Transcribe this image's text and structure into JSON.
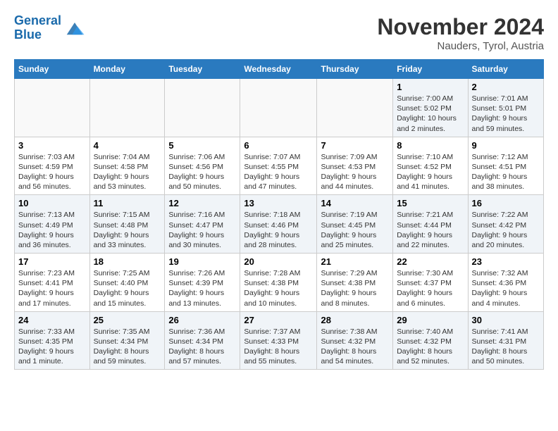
{
  "header": {
    "logo_line1": "General",
    "logo_line2": "Blue",
    "month": "November 2024",
    "location": "Nauders, Tyrol, Austria"
  },
  "weekdays": [
    "Sunday",
    "Monday",
    "Tuesday",
    "Wednesday",
    "Thursday",
    "Friday",
    "Saturday"
  ],
  "weeks": [
    [
      {
        "day": "",
        "info": ""
      },
      {
        "day": "",
        "info": ""
      },
      {
        "day": "",
        "info": ""
      },
      {
        "day": "",
        "info": ""
      },
      {
        "day": "",
        "info": ""
      },
      {
        "day": "1",
        "info": "Sunrise: 7:00 AM\nSunset: 5:02 PM\nDaylight: 10 hours and 2 minutes."
      },
      {
        "day": "2",
        "info": "Sunrise: 7:01 AM\nSunset: 5:01 PM\nDaylight: 9 hours and 59 minutes."
      }
    ],
    [
      {
        "day": "3",
        "info": "Sunrise: 7:03 AM\nSunset: 4:59 PM\nDaylight: 9 hours and 56 minutes."
      },
      {
        "day": "4",
        "info": "Sunrise: 7:04 AM\nSunset: 4:58 PM\nDaylight: 9 hours and 53 minutes."
      },
      {
        "day": "5",
        "info": "Sunrise: 7:06 AM\nSunset: 4:56 PM\nDaylight: 9 hours and 50 minutes."
      },
      {
        "day": "6",
        "info": "Sunrise: 7:07 AM\nSunset: 4:55 PM\nDaylight: 9 hours and 47 minutes."
      },
      {
        "day": "7",
        "info": "Sunrise: 7:09 AM\nSunset: 4:53 PM\nDaylight: 9 hours and 44 minutes."
      },
      {
        "day": "8",
        "info": "Sunrise: 7:10 AM\nSunset: 4:52 PM\nDaylight: 9 hours and 41 minutes."
      },
      {
        "day": "9",
        "info": "Sunrise: 7:12 AM\nSunset: 4:51 PM\nDaylight: 9 hours and 38 minutes."
      }
    ],
    [
      {
        "day": "10",
        "info": "Sunrise: 7:13 AM\nSunset: 4:49 PM\nDaylight: 9 hours and 36 minutes."
      },
      {
        "day": "11",
        "info": "Sunrise: 7:15 AM\nSunset: 4:48 PM\nDaylight: 9 hours and 33 minutes."
      },
      {
        "day": "12",
        "info": "Sunrise: 7:16 AM\nSunset: 4:47 PM\nDaylight: 9 hours and 30 minutes."
      },
      {
        "day": "13",
        "info": "Sunrise: 7:18 AM\nSunset: 4:46 PM\nDaylight: 9 hours and 28 minutes."
      },
      {
        "day": "14",
        "info": "Sunrise: 7:19 AM\nSunset: 4:45 PM\nDaylight: 9 hours and 25 minutes."
      },
      {
        "day": "15",
        "info": "Sunrise: 7:21 AM\nSunset: 4:44 PM\nDaylight: 9 hours and 22 minutes."
      },
      {
        "day": "16",
        "info": "Sunrise: 7:22 AM\nSunset: 4:42 PM\nDaylight: 9 hours and 20 minutes."
      }
    ],
    [
      {
        "day": "17",
        "info": "Sunrise: 7:23 AM\nSunset: 4:41 PM\nDaylight: 9 hours and 17 minutes."
      },
      {
        "day": "18",
        "info": "Sunrise: 7:25 AM\nSunset: 4:40 PM\nDaylight: 9 hours and 15 minutes."
      },
      {
        "day": "19",
        "info": "Sunrise: 7:26 AM\nSunset: 4:39 PM\nDaylight: 9 hours and 13 minutes."
      },
      {
        "day": "20",
        "info": "Sunrise: 7:28 AM\nSunset: 4:38 PM\nDaylight: 9 hours and 10 minutes."
      },
      {
        "day": "21",
        "info": "Sunrise: 7:29 AM\nSunset: 4:38 PM\nDaylight: 9 hours and 8 minutes."
      },
      {
        "day": "22",
        "info": "Sunrise: 7:30 AM\nSunset: 4:37 PM\nDaylight: 9 hours and 6 minutes."
      },
      {
        "day": "23",
        "info": "Sunrise: 7:32 AM\nSunset: 4:36 PM\nDaylight: 9 hours and 4 minutes."
      }
    ],
    [
      {
        "day": "24",
        "info": "Sunrise: 7:33 AM\nSunset: 4:35 PM\nDaylight: 9 hours and 1 minute."
      },
      {
        "day": "25",
        "info": "Sunrise: 7:35 AM\nSunset: 4:34 PM\nDaylight: 8 hours and 59 minutes."
      },
      {
        "day": "26",
        "info": "Sunrise: 7:36 AM\nSunset: 4:34 PM\nDaylight: 8 hours and 57 minutes."
      },
      {
        "day": "27",
        "info": "Sunrise: 7:37 AM\nSunset: 4:33 PM\nDaylight: 8 hours and 55 minutes."
      },
      {
        "day": "28",
        "info": "Sunrise: 7:38 AM\nSunset: 4:32 PM\nDaylight: 8 hours and 54 minutes."
      },
      {
        "day": "29",
        "info": "Sunrise: 7:40 AM\nSunset: 4:32 PM\nDaylight: 8 hours and 52 minutes."
      },
      {
        "day": "30",
        "info": "Sunrise: 7:41 AM\nSunset: 4:31 PM\nDaylight: 8 hours and 50 minutes."
      }
    ]
  ]
}
